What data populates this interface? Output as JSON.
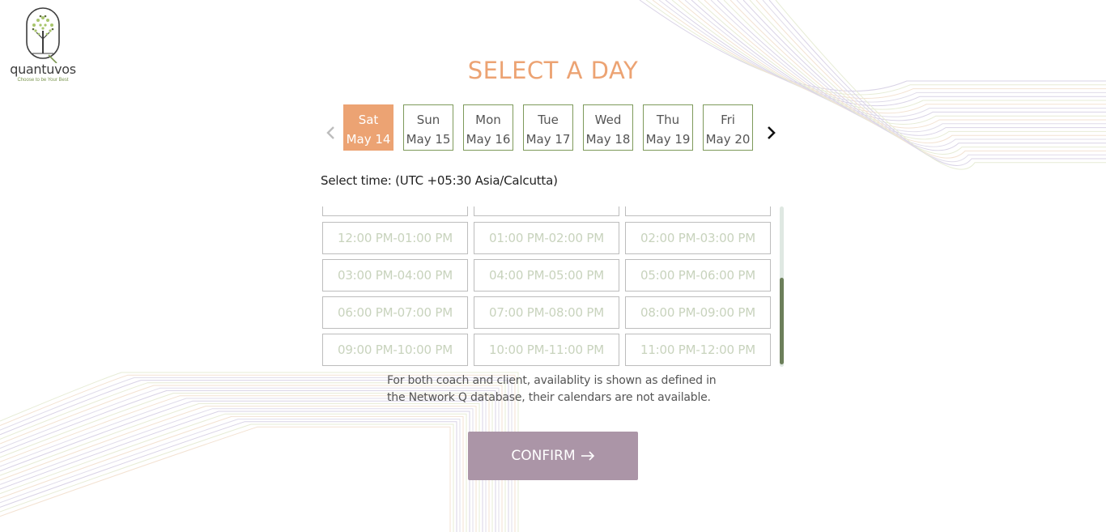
{
  "brand": {
    "logo_icon": "tree-logo-icon",
    "name": "quantuvos",
    "tagline": "Choose to be Your Best",
    "colors": {
      "accent": "#eca373",
      "green": "#7e9a5b",
      "confirm": "#ab95a7"
    }
  },
  "page_title": "SELECT A DAY",
  "day_nav": {
    "prev_icon": "chevron-left-icon",
    "next_icon": "chevron-right-icon",
    "days": [
      {
        "dow": "Sat",
        "date": "May 14",
        "selected": true
      },
      {
        "dow": "Sun",
        "date": "May 15",
        "selected": false
      },
      {
        "dow": "Mon",
        "date": "May 16",
        "selected": false
      },
      {
        "dow": "Tue",
        "date": "May 17",
        "selected": false
      },
      {
        "dow": "Wed",
        "date": "May 18",
        "selected": false
      },
      {
        "dow": "Thu",
        "date": "May 19",
        "selected": false
      },
      {
        "dow": "Fri",
        "date": "May 20",
        "selected": false
      }
    ]
  },
  "time_label": "Select time: (UTC +05:30 Asia/Calcutta)",
  "slots": [
    "12:00 PM-01:00 PM",
    "01:00 PM-02:00 PM",
    "02:00 PM-03:00 PM",
    "03:00 PM-04:00 PM",
    "04:00 PM-05:00 PM",
    "05:00 PM-06:00 PM",
    "06:00 PM-07:00 PM",
    "07:00 PM-08:00 PM",
    "08:00 PM-09:00 PM",
    "09:00 PM-10:00 PM",
    "10:00 PM-11:00 PM",
    "11:00 PM-12:00 PM"
  ],
  "note_line1": "For both coach and client, availablity is shown as defined in",
  "note_line2": "the Network Q database, their calendars are not available.",
  "confirm": {
    "label": "CONFIRM",
    "icon": "arrow-right-icon"
  }
}
